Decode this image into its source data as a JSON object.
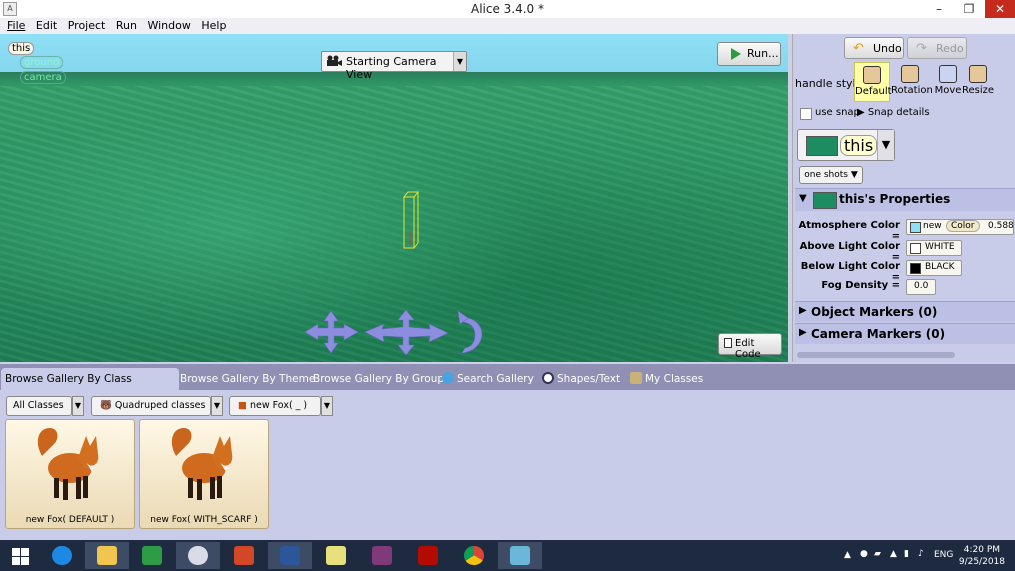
{
  "window": {
    "title": "Alice 3.4.0  *",
    "app_icon": "alice-app-icon"
  },
  "menu": [
    "File",
    "Edit",
    "Project",
    "Run",
    "Window",
    "Help"
  ],
  "scene": {
    "tree": {
      "root": "this",
      "children": [
        "ground",
        "camera"
      ]
    },
    "camera_view": "Starting Camera View",
    "run_label": "Run...",
    "edit_code_label": "Edit Code"
  },
  "toolbar": {
    "undo": "Undo",
    "redo": "Redo"
  },
  "handle_style": {
    "label": "handle style:",
    "options": [
      "Default",
      "Rotation",
      "Move",
      "Resize"
    ],
    "selected": "Default"
  },
  "snap": {
    "label": "use snap",
    "details": "Snap details",
    "checked": false
  },
  "selected_object": {
    "name": "this",
    "color": "#1d8c61"
  },
  "one_shots": "one shots ▼",
  "properties": {
    "header": "this's Properties",
    "atmosphere": {
      "label": "Atmosphere Color =",
      "new": "new",
      "ctor": "Color",
      "value": "0.588"
    },
    "above_light": {
      "label": "Above Light Color =",
      "value": "WHITE"
    },
    "below_light": {
      "label": "Below Light Color =",
      "value": "BLACK"
    },
    "fog": {
      "label": "Fog Density =",
      "value": "0.0"
    }
  },
  "markers": {
    "object": "Object Markers (0)",
    "camera": "Camera Markers (0)"
  },
  "gallery": {
    "tabs": [
      "Browse Gallery By Class Hierarchy",
      "Browse Gallery By Theme",
      "Browse Gallery By Group",
      "Search Gallery",
      "Shapes/Text",
      "My Classes"
    ],
    "breadcrumb": [
      "All Classes",
      "Quadruped classes",
      "new Fox( _ )"
    ],
    "items": [
      "new Fox( DEFAULT )",
      "new Fox( WITH_SCARF )"
    ]
  },
  "taskbar": {
    "lang": "ENG",
    "time": "4:20 PM",
    "date": "9/25/2018"
  }
}
